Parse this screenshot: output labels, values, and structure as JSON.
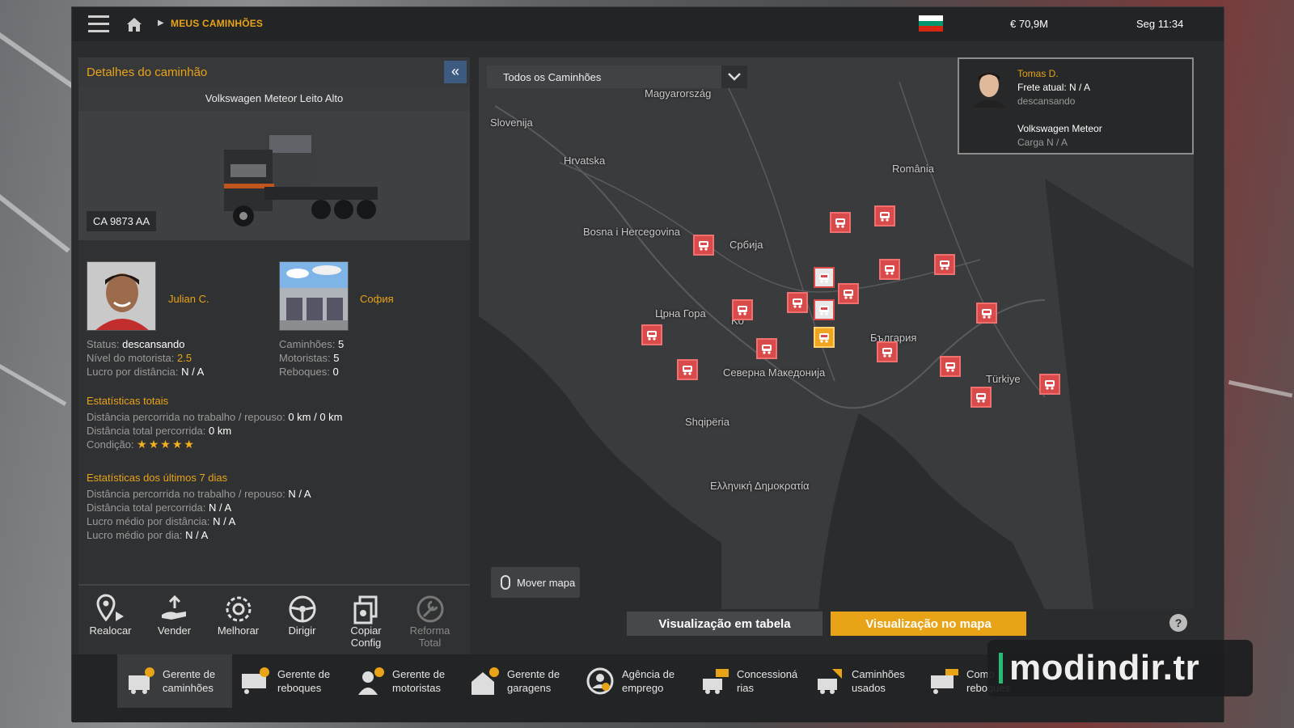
{
  "topbar": {
    "breadcrumb": "MEUS CAMINHÕES",
    "money": "€ 70,9M",
    "time": "Seg 11:34",
    "icons": [
      "menu-icon",
      "home-icon",
      "chevron-right-icon",
      "bulgaria-flag-icon"
    ]
  },
  "details": {
    "title": "Detalhes do caminhão",
    "collapse_glyph": "«",
    "model": "Volkswagen Meteor Leito Alto",
    "plate": "CA 9873 AA",
    "driver_name": "Julian C.",
    "garage_name": "София",
    "status_label": "Status:",
    "status_value": "descansando",
    "level_label": "Nível do motorista:",
    "level_value": "2.5",
    "profit_label": "Lucro por distância:",
    "profit_value": "N / A",
    "trucks_label": "Caminhões:",
    "trucks_value": "5",
    "drivers_label": "Motoristas:",
    "drivers_value": "5",
    "trailers_label": "Reboques:",
    "trailers_value": "0",
    "total_title": "Estatísticas totais",
    "total_dist_work_label": "Distância percorrida no trabalho / repouso:",
    "total_dist_work_value": "0 km / 0 km",
    "total_dist_label": "Distância total percorrida:",
    "total_dist_value": "0 km",
    "condition_label": "Condição:",
    "condition_stars": 5,
    "last7_title": "Estatísticas dos últimos 7 dias",
    "l7_work_label": "Distância percorrida no trabalho / repouso:",
    "l7_work_value": "N / A",
    "l7_total_label": "Distância total percorrida:",
    "l7_total_value": "N / A",
    "l7_avgdist_label": "Lucro médio por distância:",
    "l7_avgdist_value": "N / A",
    "l7_avgday_label": "Lucro médio por dia:",
    "l7_avgday_value": "N / A"
  },
  "actions": [
    {
      "label": "Realocar",
      "icon": "relocate-icon",
      "enabled": true
    },
    {
      "label": "Vender",
      "icon": "sell-icon",
      "enabled": true
    },
    {
      "label": "Melhorar",
      "icon": "upgrade-icon",
      "enabled": true
    },
    {
      "label": "Dirigir",
      "icon": "steering-wheel-icon",
      "enabled": true
    },
    {
      "label": "Copiar Config",
      "icon": "copy-config-icon",
      "enabled": true
    },
    {
      "label": "Reforma Total",
      "icon": "wrench-icon",
      "enabled": false
    }
  ],
  "map": {
    "filter": "Todos os Caminhões",
    "move_map": "Mover mapa",
    "labels": [
      "Magyarország",
      "Slovenija",
      "Hrvatska",
      "România",
      "Bosna i Hercegovina",
      "Србија",
      "Црна Гора",
      "Ko",
      "България",
      "Северна Македонија",
      "Türkiye",
      "Shqipëria",
      "Ελληνική Δημοκρατία"
    ],
    "card": {
      "name": "Tomas D.",
      "freight": "Frete atual: N / A",
      "status": "descansando",
      "truck": "Volkswagen Meteor",
      "cargo": "Carga N / A"
    }
  },
  "view": {
    "table": "Visualização em tabela",
    "map": "Visualização no mapa",
    "help": "?"
  },
  "bottom_tabs": [
    {
      "label": "Gerente de caminhões",
      "icon": "truck-manager-icon",
      "active": true
    },
    {
      "label": "Gerente de reboques",
      "icon": "trailer-manager-icon",
      "active": false
    },
    {
      "label": "Gerente de motoristas",
      "icon": "driver-manager-icon",
      "active": false
    },
    {
      "label": "Gerente de garagens",
      "icon": "garage-manager-icon",
      "active": false
    },
    {
      "label": "Agência de emprego",
      "icon": "recruitment-icon",
      "active": false
    },
    {
      "label": "Concessioná rias",
      "icon": "dealership-icon",
      "active": false
    },
    {
      "label": "Caminhões usados",
      "icon": "used-trucks-icon",
      "active": false
    },
    {
      "label": "Comp reboques",
      "icon": "buy-trailers-icon",
      "active": false
    }
  ],
  "watermark": "modindir.tr",
  "colors": {
    "accent": "#e8a317",
    "marker": "#d94a4a",
    "active_button": "#e8a317"
  }
}
